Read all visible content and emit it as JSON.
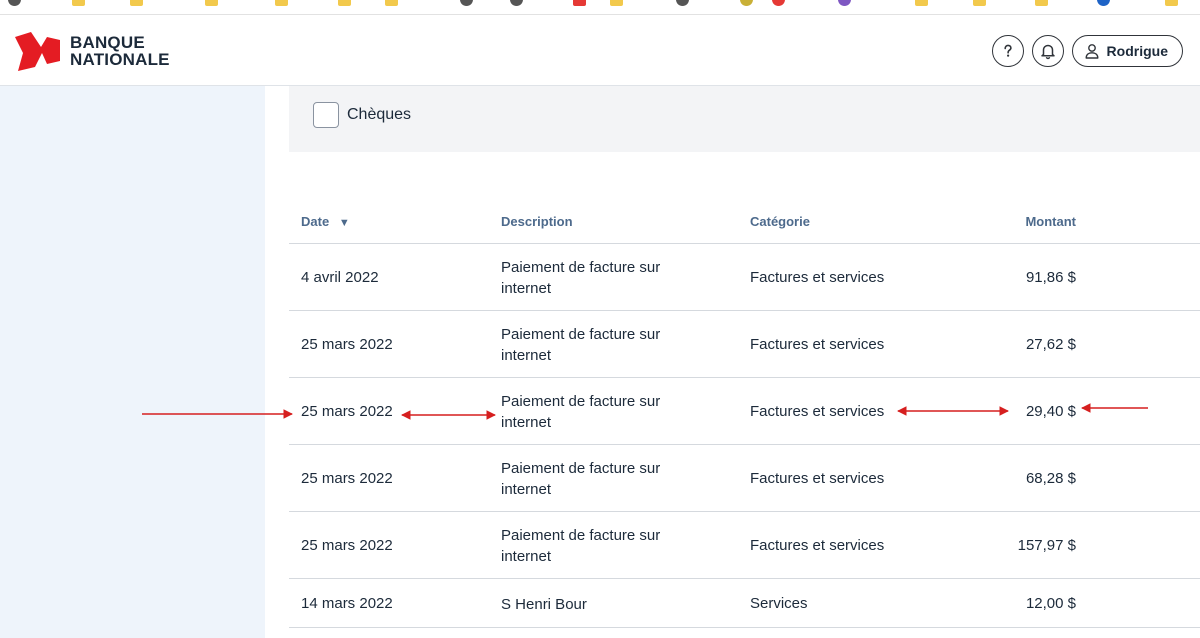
{
  "header": {
    "logo_line1": "BANQUE",
    "logo_line2": "NATIONALE",
    "user_name": "Rodrigue",
    "brand_color": "#e41c23"
  },
  "filter": {
    "checkbox_label": "Chèques"
  },
  "table": {
    "columns": {
      "date": "Date",
      "sort_indicator": "▼",
      "description": "Description",
      "category": "Catégorie",
      "amount": "Montant"
    },
    "rows": [
      {
        "date": "4 avril 2022",
        "description": "Paiement de facture sur internet",
        "category": "Factures et services",
        "amount": "91,86 $"
      },
      {
        "date": "25 mars 2022",
        "description": "Paiement de facture sur internet",
        "category": "Factures et services",
        "amount": "27,62 $"
      },
      {
        "date": "25 mars 2022",
        "description": "Paiement de facture sur internet",
        "category": "Factures et services",
        "amount": "29,40 $"
      },
      {
        "date": "25 mars 2022",
        "description": "Paiement de facture sur internet",
        "category": "Factures et services",
        "amount": "68,28 $"
      },
      {
        "date": "25 mars 2022",
        "description": "Paiement de facture sur internet",
        "category": "Factures et services",
        "amount": "157,97 $"
      },
      {
        "date": "14 mars 2022",
        "description": "S Henri Bour",
        "category": "Services",
        "amount": "12,00 $"
      }
    ]
  },
  "annotations": {
    "arrow_color": "#d61f1f",
    "highlighted_row": 3
  }
}
